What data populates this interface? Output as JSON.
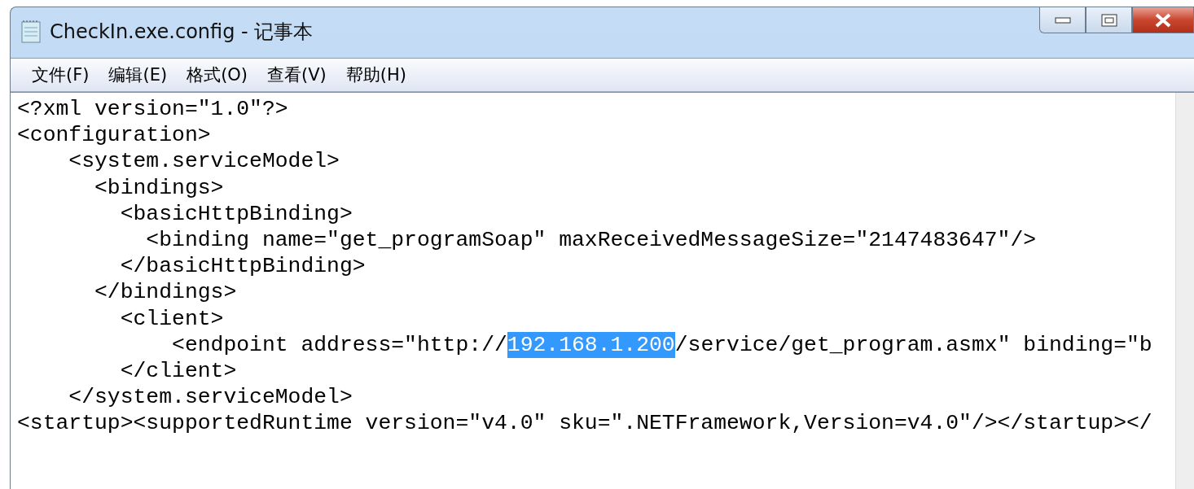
{
  "window": {
    "title": "CheckIn.exe.config - 记事本"
  },
  "menu": [
    {
      "label": "文件(F)"
    },
    {
      "label": "编辑(E)"
    },
    {
      "label": "格式(O)"
    },
    {
      "label": "查看(V)"
    },
    {
      "label": "帮助(H)"
    }
  ],
  "editor": {
    "lines": [
      {
        "parts": [
          {
            "text": "<?xml version=\"1.0\"?>",
            "selected": false
          }
        ]
      },
      {
        "parts": [
          {
            "text": "<configuration>",
            "selected": false
          }
        ]
      },
      {
        "parts": [
          {
            "text": "    <system.serviceModel>",
            "selected": false
          }
        ]
      },
      {
        "parts": [
          {
            "text": "      <bindings>",
            "selected": false
          }
        ]
      },
      {
        "parts": [
          {
            "text": "        <basicHttpBinding>",
            "selected": false
          }
        ]
      },
      {
        "parts": [
          {
            "text": "          <binding name=\"get_programSoap\" maxReceivedMessageSize=\"2147483647\"/>",
            "selected": false
          }
        ]
      },
      {
        "parts": [
          {
            "text": "        </basicHttpBinding>",
            "selected": false
          }
        ]
      },
      {
        "parts": [
          {
            "text": "      </bindings>",
            "selected": false
          }
        ]
      },
      {
        "parts": [
          {
            "text": "        <client>",
            "selected": false
          }
        ]
      },
      {
        "parts": [
          {
            "text": "            <endpoint address=\"http://",
            "selected": false
          },
          {
            "text": "192.168.1.200",
            "selected": true
          },
          {
            "text": "/service/get_program.asmx\" binding=\"b",
            "selected": false
          }
        ]
      },
      {
        "parts": [
          {
            "text": "        </client>",
            "selected": false
          }
        ]
      },
      {
        "parts": [
          {
            "text": "    </system.serviceModel>",
            "selected": false
          }
        ]
      },
      {
        "parts": [
          {
            "text": "<startup><supportedRuntime version=\"v4.0\" sku=\".NETFramework,Version=v4.0\"/></startup></",
            "selected": false
          }
        ]
      }
    ]
  }
}
